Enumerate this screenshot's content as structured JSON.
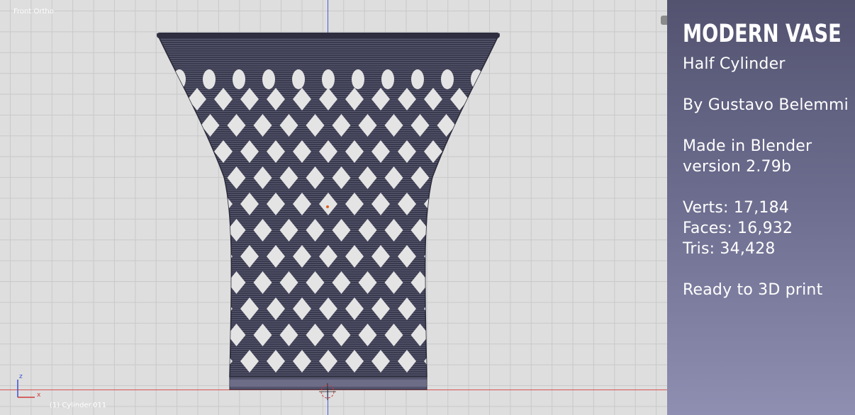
{
  "viewport": {
    "view_name": "Front Ortho",
    "object_name": "(1) Cylinder.011",
    "axis_z": "z",
    "axis_x": "x"
  },
  "info_panel": {
    "title": "MODERN VASE",
    "subtitle": "Half Cylinder",
    "author": "By Gustavo Belemmi",
    "made_in": "Made in Blender",
    "version": "version 2.79b",
    "verts": "Verts: 17,184",
    "faces": "Faces: 16,932",
    "tris": "Tris: 34,428",
    "note": "Ready to 3D print"
  },
  "colors": {
    "grid_bg": "#dedede",
    "vase": "#3a3a4f",
    "panel_top": "#535370",
    "panel_bottom": "#8f8fb2",
    "axis_x": "#d95050",
    "axis_y": "#4d5bd6"
  }
}
